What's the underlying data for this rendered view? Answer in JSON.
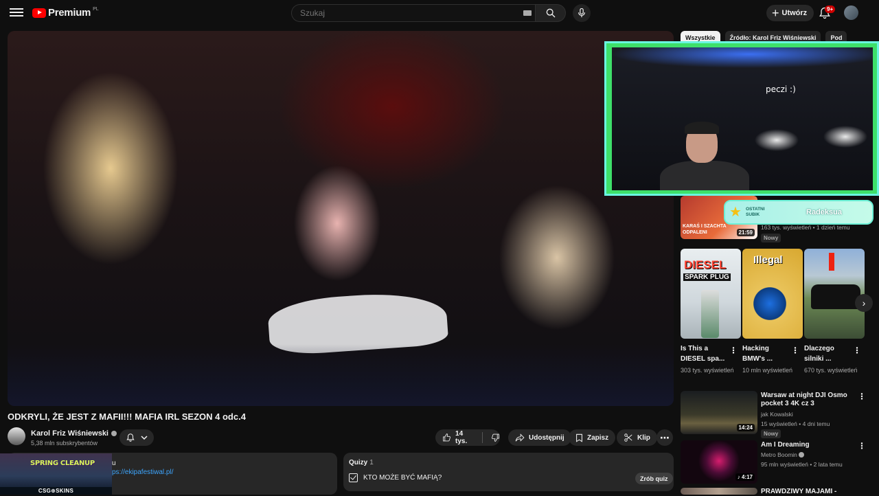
{
  "header": {
    "brand": "Premium",
    "region": "PL",
    "search_placeholder": "Szukaj",
    "create_label": "Utwórz",
    "notif_count": "9+"
  },
  "video": {
    "title": "ODKRYLI, ŻE JEST Z MAFII!!! MAFIA IRL SEZON 4 odc.4",
    "channel": "Karol Friz Wiśniewski",
    "subscribers": "5,38 mln subskrybentów",
    "likes": "14 tys.",
    "share_label": "Udostępnij",
    "save_label": "Zapisz",
    "clip_label": "Klip"
  },
  "description": {
    "prefix": "u",
    "link": "ps://ekipafestiwal.pl/"
  },
  "quiz": {
    "heading": "Quizy",
    "count": "1",
    "question": "KTO MOŻE BYĆ MAFIĄ?",
    "button": "Zrób quiz"
  },
  "promo": {
    "banner": "SPRING CLEANUP",
    "footer": "CSG⊕SKINS"
  },
  "chips": [
    {
      "label": "Wszystkie",
      "active": true
    },
    {
      "label": "Źródło: Karol Friz Wiśniewski",
      "active": false
    },
    {
      "label": "Pod",
      "active": false
    }
  ],
  "webcam": {
    "caption": "peczi :)"
  },
  "subathon": {
    "label_line1": "OSTATNI",
    "label_line2": "SUBIK",
    "name": "Radeksua"
  },
  "recs": [
    {
      "title": "",
      "meta1": "163 tys. wyświetleń • 1 dzień temu",
      "badge": "Nowy",
      "duration": "21:59",
      "thumb_text": "KARAŚ I SZACHTA ODPALENI"
    },
    {
      "title": "Warsaw at night  DJI Osmo pocket 3 4K cz  3",
      "channel": "jak Kowalski",
      "meta1": "15 wyświetleń • 4 dni temu",
      "badge": "Nowy",
      "duration": "14:24"
    },
    {
      "title": "Am I Dreaming",
      "channel": "Metro Boomin",
      "meta1": "95 mln wyświetleń • 2 lata temu",
      "duration": "4:17"
    },
    {
      "title": "PRAWDZIWY MAJAMI -"
    }
  ],
  "cards": [
    {
      "title": "Is This a DIESEL spa...",
      "views": "303 tys. wyświetleń",
      "thumb_text1": "DIESEL",
      "thumb_text2": "SPARK PLUG"
    },
    {
      "title": "Hacking BMW's ...",
      "views": "10 mln wyświetleń",
      "thumb_text1": "Illegal"
    },
    {
      "title": "Dlaczego silniki ...",
      "views": "670 tys. wyświetleń"
    }
  ],
  "colors": {
    "background": "#0f0f0f",
    "accent_red": "#ff0000",
    "link": "#3ea6ff",
    "webcam_frame": "#3ee06a"
  }
}
